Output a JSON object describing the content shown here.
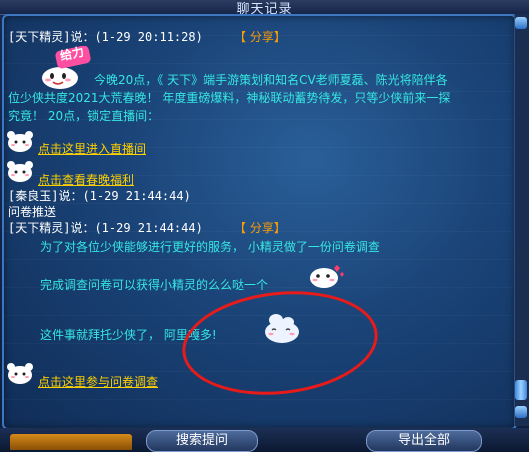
{
  "window": {
    "title": "聊天记录"
  },
  "messages": {
    "m1": {
      "header": "[天下精灵]说：(1-29 20:11:28)",
      "share": "【 分享】",
      "gift_badge": "给力",
      "line1": "今晚20点，《 天下》端手游策划和知名CV老师夏磊、陈光将陪伴各",
      "line2": "位少侠共度2021大荒春晚！ 年度重磅爆料，神秘联动蓄势待发，只等少侠前来一探",
      "line3": "究竟！ 20点，锁定直播间：",
      "link1": "点击这里进入直播间",
      "link2": "点击查看春晚福利"
    },
    "m2": {
      "header": "[秦良玉]说：(1-29 21:44:44)",
      "body": "问卷推送"
    },
    "m3": {
      "header": "[天下精灵]说：(1-29 21:44:44)",
      "share": "【 分享】",
      "line1": "为了对各位少侠能够进行更好的服务， 小精灵做了一份问卷调查",
      "line2": "完成调查问卷可以获得小精灵的么么哒一个",
      "line3": "这件事就拜托少侠了， 阿里嘎多!",
      "link": "点击这里参与问卷调查"
    }
  },
  "buttons": {
    "search": "搜索提问",
    "export": "导出全部"
  },
  "colors": {
    "cyan_text": "#36e7e3",
    "link_text": "#ffd000",
    "share_text": "#ff9c00",
    "annotation": "#e81b1b"
  }
}
